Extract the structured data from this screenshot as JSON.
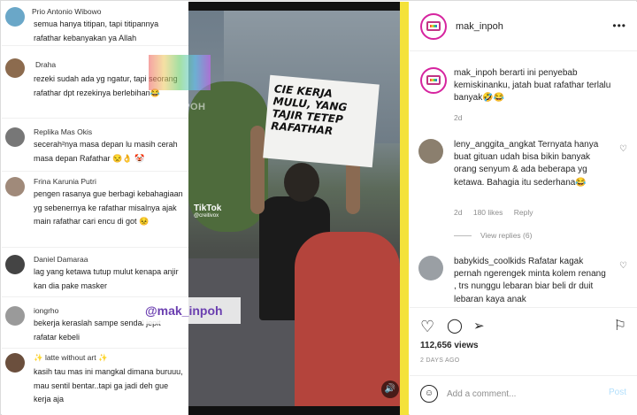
{
  "left_comments": [
    {
      "name": "Prio Antonio Wibowo",
      "text": "semua hanya titipan, tapi titipannya rafathar kebanyakan ya Allah"
    },
    {
      "name": "Draha",
      "text": "rezeki sudah ada yg ngatur, tapi seorang rafathar dpt rezekinya berlebihan😂"
    },
    {
      "name": "Replika Mas Okis",
      "text": "secerah²nya masa depan lu masih cerah masa depan Rafathar 😒👌 🤡"
    },
    {
      "name": "Frina Karunia Putri",
      "text": "pengen rasanya gue berbagi kebahagiaan yg sebenernya ke rafathar misalnya ajak main rafathar cari encu di got 😣"
    },
    {
      "name": "Daniel Damaraa",
      "text": "lag yang ketawa tutup mulut kenapa anjir kan dia pake masker"
    },
    {
      "name": "iongrho",
      "text": "bekerja keraslah sampe sendal jepit rafatar kebeli"
    },
    {
      "name": "✨ latte without art ✨",
      "text": "kasih tau mas ini mangkal dimana buruuu, mau sentil bentar..tapi ga jadi deh gue kerja aja"
    }
  ],
  "video": {
    "sign_text": "CIE KERJA MULU, YANG TAJIR TETEP RAFATHAR",
    "tiktok_label": "TikTok",
    "tiktok_handle": "@creitivox",
    "watermark": "MAK_INPOH",
    "overlay_tag": "@mak_inpoh"
  },
  "post": {
    "username": "mak_inpoh",
    "more_label": "•••",
    "caption_user": "mak_inpoh",
    "caption_text": "berarti ini penyebab kemiskinanku, jatah buat rafathar terlalu banyak🤣😂",
    "caption_time": "2d",
    "comments": [
      {
        "user": "leny_anggita_angkat",
        "text": "Ternyata hanya buat gituan udah bisa bikin banyak orang senyum & ada beberapa yg ketawa. Bahagia itu sederhana😂",
        "time": "2d",
        "likes": "180 likes",
        "reply": "Reply",
        "view_replies": "View replies (6)"
      },
      {
        "user": "babykids_coolkids",
        "text": "Rafatar kagak pernah ngerengek minta kolem renang , trs nunggu lebaran biar beli dr duit lebaran kaya anak"
      }
    ],
    "views": "112,656 views",
    "ago": "2 DAYS AGO",
    "comment_placeholder": "Add a comment...",
    "post_label": "Post"
  },
  "icons": {
    "heart": "heart-icon",
    "comment": "comment-icon",
    "share": "share-icon",
    "bookmark": "bookmark-icon",
    "emoji": "emoji-icon",
    "sound": "sound-icon"
  }
}
